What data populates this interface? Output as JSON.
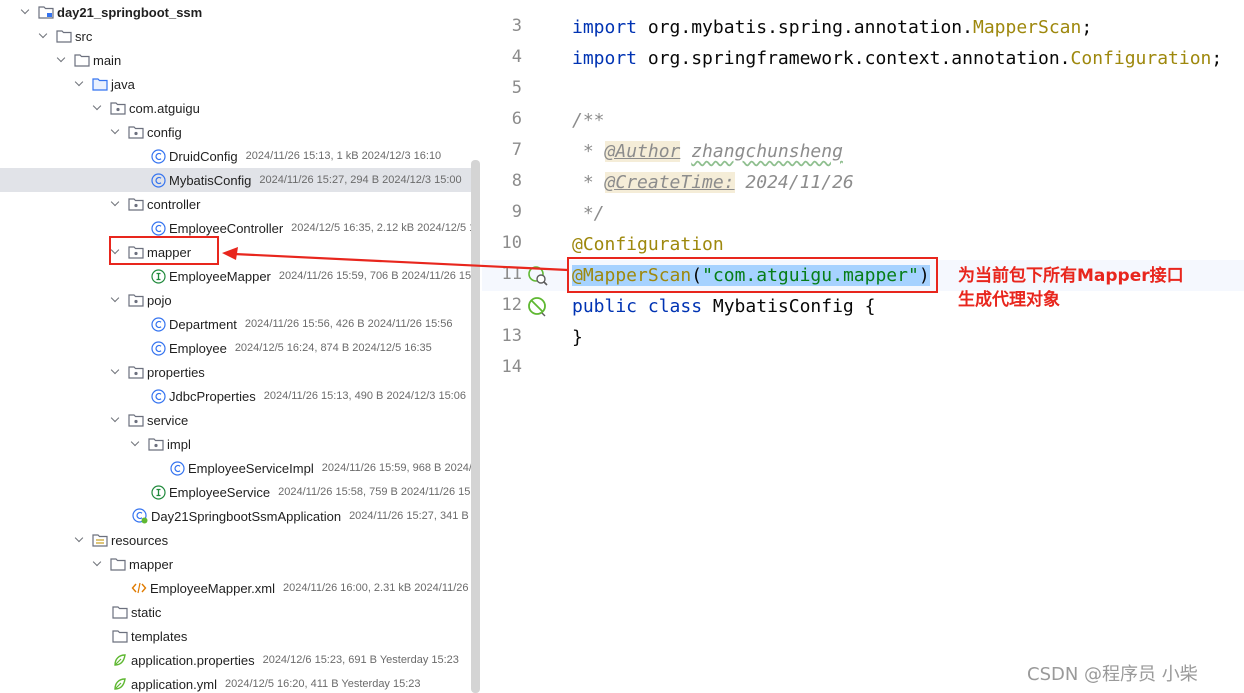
{
  "tree": {
    "items": [
      {
        "label": "day21_springboot_ssm",
        "meta": ""
      },
      {
        "label": "src",
        "meta": ""
      },
      {
        "label": "main",
        "meta": ""
      },
      {
        "label": "java",
        "meta": ""
      },
      {
        "label": "com.atguigu",
        "meta": ""
      },
      {
        "label": "config",
        "meta": ""
      },
      {
        "label": "DruidConfig",
        "meta": "2024/11/26 15:13, 1 kB 2024/12/3 16:10"
      },
      {
        "label": "MybatisConfig",
        "meta": "2024/11/26 15:27, 294 B 2024/12/3 15:00"
      },
      {
        "label": "controller",
        "meta": ""
      },
      {
        "label": "EmployeeController",
        "meta": "2024/12/5 16:35, 2.12 kB 2024/12/5 1"
      },
      {
        "label": "mapper",
        "meta": ""
      },
      {
        "label": "EmployeeMapper",
        "meta": "2024/11/26 15:59, 706 B 2024/11/26 15"
      },
      {
        "label": "pojo",
        "meta": ""
      },
      {
        "label": "Department",
        "meta": "2024/11/26 15:56, 426 B 2024/11/26 15:56"
      },
      {
        "label": "Employee",
        "meta": "2024/12/5 16:24, 874 B 2024/12/5 16:35"
      },
      {
        "label": "properties",
        "meta": ""
      },
      {
        "label": "JdbcProperties",
        "meta": "2024/11/26 15:13, 490 B 2024/12/3 15:06"
      },
      {
        "label": "service",
        "meta": ""
      },
      {
        "label": "impl",
        "meta": ""
      },
      {
        "label": "EmployeeServiceImpl",
        "meta": "2024/11/26 15:59, 968 B 2024/1"
      },
      {
        "label": "EmployeeService",
        "meta": "2024/11/26 15:58, 759 B 2024/11/26 15:5"
      },
      {
        "label": "Day21SpringbootSsmApplication",
        "meta": "2024/11/26 15:27, 341 B Y"
      },
      {
        "label": "resources",
        "meta": ""
      },
      {
        "label": "mapper",
        "meta": ""
      },
      {
        "label": "EmployeeMapper.xml",
        "meta": "2024/11/26 16:00, 2.31 kB 2024/11/26"
      },
      {
        "label": "static",
        "meta": ""
      },
      {
        "label": "templates",
        "meta": ""
      },
      {
        "label": "application.properties",
        "meta": "2024/12/6 15:23, 691 B Yesterday 15:23"
      },
      {
        "label": "application.yml",
        "meta": "2024/12/5 16:20, 411 B Yesterday 15:23"
      }
    ]
  },
  "editor": {
    "line_numbers": [
      "3",
      "4",
      "5",
      "6",
      "7",
      "8",
      "9",
      "10",
      "11",
      "12",
      "13",
      "14"
    ],
    "code": {
      "l3_kw": "import",
      "l3_text": " org.mybatis.spring.annotation.",
      "l3_cls": "MapperScan",
      "l3_end": ";",
      "l4_kw": "import",
      "l4_text": " org.springframework.context.annotation.",
      "l4_cls": "Configuration",
      "l4_end": ";",
      "l6": "/**",
      "l7_star": " * ",
      "l7_tag": "@Author",
      "l7_val": "zhangchunsheng",
      "l8_star": " * ",
      "l8_tag": "@CreateTime:",
      "l8_val": " 2024/11/26",
      "l9": " */",
      "l10": "@Configuration",
      "l11_anno": "@MapperScan",
      "l11_open": "(",
      "l11_str": "\"com.atguigu.mapper\"",
      "l11_close": ")",
      "l12_kw": "public class",
      "l12_rest": " MybatisConfig {",
      "l13": "}"
    }
  },
  "annotation": {
    "note_line1": "为当前包下所有Mapper接口",
    "note_line2": "生成代理对象"
  },
  "watermark": "CSDN @程序员 小柴",
  "colors": {
    "highlight": "#e8261d",
    "keyword": "#0033b3",
    "annotation": "#9e880d",
    "string": "#067d17",
    "selection": "#a6d2ff"
  }
}
